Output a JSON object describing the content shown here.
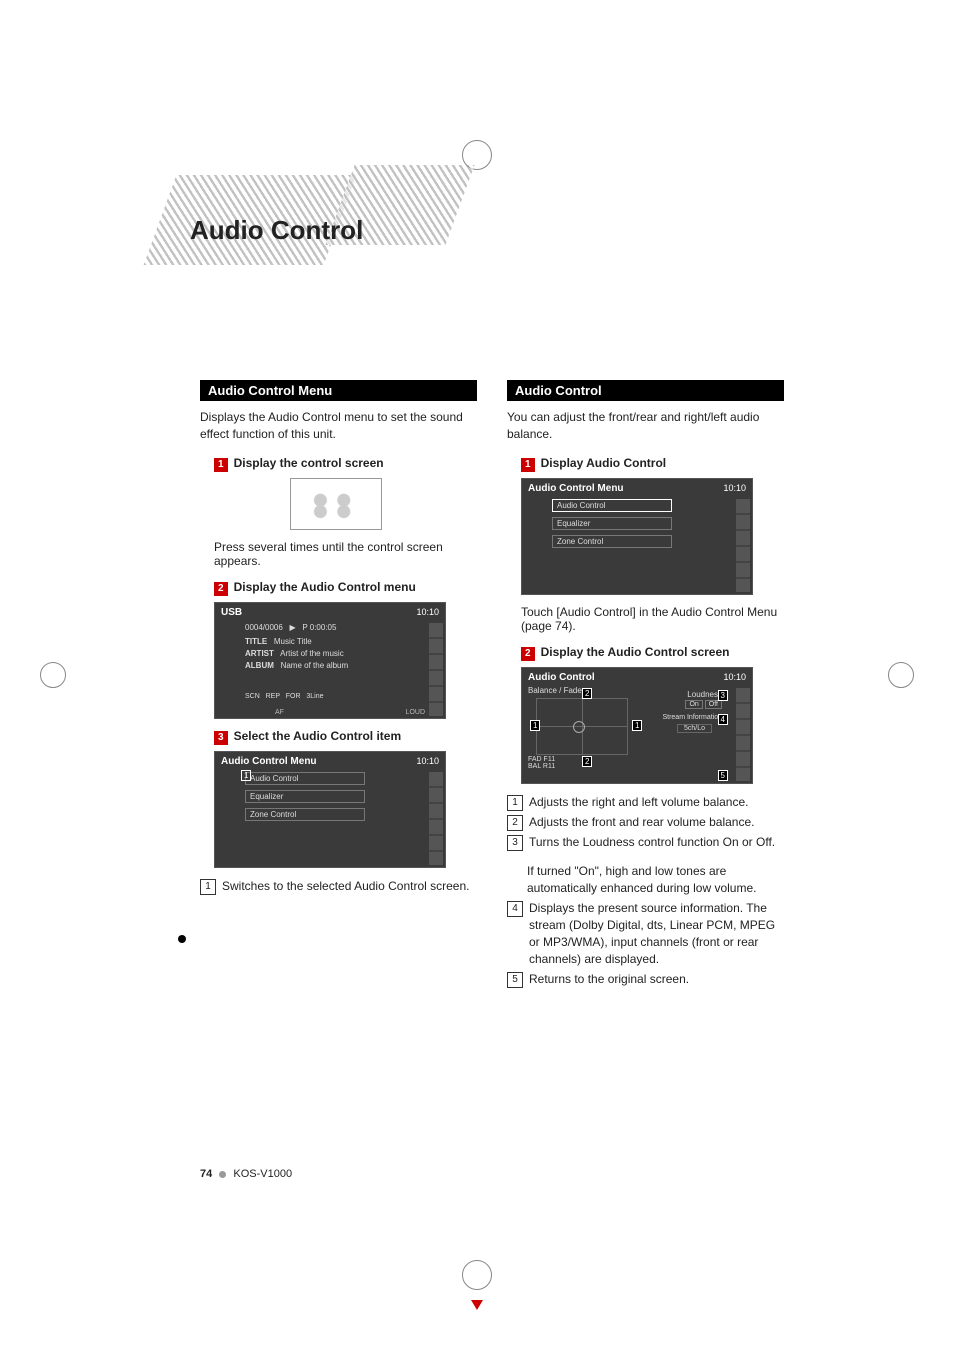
{
  "section_title": "Audio Control",
  "left": {
    "header": "Audio Control Menu",
    "intro": "Displays the Audio Control menu to set the sound effect function of this unit.",
    "steps": {
      "1": {
        "label": "Display the control screen"
      },
      "1_note": "Press several times until the control screen appears.",
      "2": {
        "label": "Display the Audio Control menu"
      },
      "3": {
        "label": "Select the Audio Control item"
      }
    },
    "screenshot_usb": {
      "title": "USB",
      "time": "10:10",
      "track": "0004/0006",
      "ptime": "P   0:00:05",
      "row1_label": "TITLE",
      "row1_value": "Music Title",
      "row2_label": "ARTIST",
      "row2_value": "Artist of the music",
      "row3_label": "ALBUM",
      "row3_value": "Name of the album",
      "bottom": [
        "SCN",
        "REP",
        "FOR",
        "3Line"
      ],
      "footer_left": "AF",
      "footer_right": "LOUD"
    },
    "screenshot_menu": {
      "title": "Audio Control Menu",
      "time": "10:10",
      "items": [
        "Audio Control",
        "Equalizer",
        "Zone Control"
      ]
    },
    "callout": {
      "1": "Switches to the selected Audio Control screen."
    }
  },
  "right": {
    "header": "Audio Control",
    "intro": "You can adjust the front/rear and right/left audio balance.",
    "steps": {
      "1": {
        "label": "Display Audio Control"
      },
      "1_note": "Touch [Audio Control] in the Audio Control Menu (page 74).",
      "2": {
        "label": "Display the Audio Control screen"
      }
    },
    "screenshot_menu": {
      "title": "Audio Control Menu",
      "time": "10:10",
      "items": [
        "Audio Control",
        "Equalizer",
        "Zone Control"
      ]
    },
    "screenshot_ac": {
      "title": "Audio Control",
      "time": "10:10",
      "sub": "Balance / Fader",
      "loudness_label": "Loudness",
      "loudness_on": "On",
      "loudness_off": "Off",
      "stream_label": "Stream Information",
      "stream_value": "5ch/Lo",
      "status": "FAD F11\nBAL R11"
    },
    "callouts": {
      "1": "Adjusts the right and left volume balance.",
      "2": "Adjusts the front and rear volume balance.",
      "3": "Turns the Loudness control function On or Off.",
      "3_note": "If turned \"On\", high and low tones are automatically enhanced during low volume.",
      "4": "Displays the present source information. The stream (Dolby Digital, dts, Linear PCM, MPEG or MP3/WMA), input channels (front or  rear channels) are displayed.",
      "5": "Returns to the original screen."
    }
  },
  "footer": {
    "page": "74",
    "model": "KOS-V1000"
  }
}
